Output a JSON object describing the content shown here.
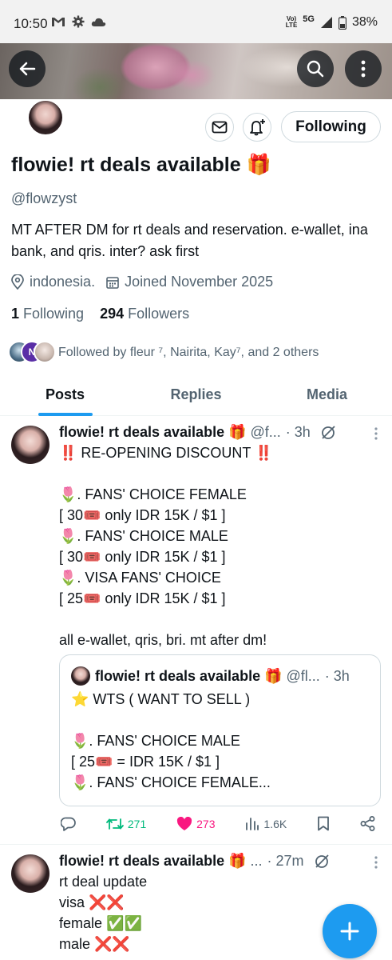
{
  "status_bar": {
    "time": "10:50",
    "network": "5G",
    "volte_top": "Vo)",
    "volte_bottom": "LTE",
    "battery": "38%"
  },
  "profile": {
    "display_name": "flowie! rt deals available 🎁",
    "handle": "@flowzyst",
    "bio": "MT AFTER DM for rt deals and reservation. e-wallet, ina bank, and qris. inter? ask first",
    "location": "indonesia.",
    "joined": "Joined November 2025",
    "following_count": "1",
    "following_label": "Following",
    "followers_count": "294",
    "followers_label": "Followers",
    "followed_by": "Followed by fleur ⁷, Nairita, Kay⁷, and 2 others",
    "follow_button_label": "Following",
    "mini_avatar_letter": "N"
  },
  "tabs": [
    {
      "label": "Posts",
      "active": true
    },
    {
      "label": "Replies",
      "active": false
    },
    {
      "label": "Media",
      "active": false
    }
  ],
  "tweets": [
    {
      "name": "flowie! rt deals available 🎁",
      "handle": "@f...",
      "time": "· 3h",
      "body": "‼️ RE-OPENING DISCOUNT ‼️\n\n🌷. FANS' CHOICE FEMALE\n[ 30🎟️ only IDR 15K / $1 ]\n🌷. FANS' CHOICE MALE\n[ 30🎟️ only IDR 15K / $1 ]\n🌷. VISA FANS' CHOICE\n[ 25🎟️ only IDR 15K / $1 ]\n\nall e-wallet, qris, bri. mt after dm!",
      "quote": {
        "name": "flowie! rt deals available 🎁",
        "handle": "@fl...",
        "time": "· 3h",
        "body": "⭐ WTS ( WANT TO SELL )\n\n🌷. FANS' CHOICE MALE\n [ 25🎟️ = IDR 15K / $1 ]\n🌷. FANS' CHOICE FEMALE..."
      },
      "retweets": "271",
      "likes": "273",
      "views": "1.6K"
    },
    {
      "name": "flowie! rt deals available 🎁",
      "handle": "...",
      "time": "· 27m",
      "body": "rt deal update\nvisa ❌❌\nfemale ✅✅\nmale ❌❌"
    }
  ],
  "colors": {
    "accent": "#1d9bf0",
    "retweet": "#00ba7c",
    "like": "#f91880",
    "muted": "#536471"
  },
  "icons": [
    "back-arrow-icon",
    "search-icon",
    "more-vertical-icon",
    "mail-icon",
    "bell-plus-icon",
    "location-icon",
    "calendar-icon",
    "reply-icon",
    "retweet-icon",
    "heart-icon",
    "views-icon",
    "bookmark-icon",
    "share-icon",
    "grok-icon",
    "plus-icon"
  ]
}
